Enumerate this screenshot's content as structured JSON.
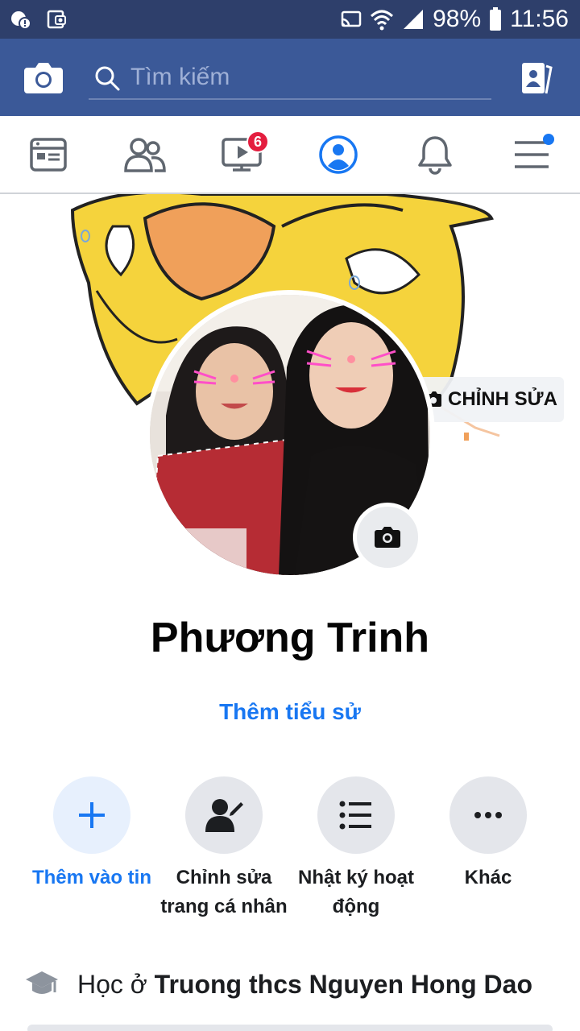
{
  "status_bar": {
    "battery": "98%",
    "time": "11:56"
  },
  "header": {
    "search_placeholder": "Tìm kiếm"
  },
  "tabs": {
    "video_badge": "6",
    "active": "profile"
  },
  "cover": {
    "edit_label": "CHỈNH SỬA"
  },
  "profile": {
    "name": "Phương Trinh",
    "add_bio": "Thêm tiểu sử"
  },
  "actions": [
    {
      "line1": "Thêm vào tin",
      "line2": "",
      "icon": "plus-icon"
    },
    {
      "line1": "Chỉnh sửa",
      "line2": "trang cá nhân",
      "icon": "edit-profile-icon"
    },
    {
      "line1": "Nhật ký hoạt",
      "line2": "động",
      "icon": "list-icon"
    },
    {
      "line1": "Khác",
      "line2": "",
      "icon": "more-icon"
    }
  ],
  "intro": {
    "prefix": "Học ở ",
    "school": "Truong thcs Nguyen Hong Dao"
  },
  "colors": {
    "status_bar": "#2e3f6b",
    "header": "#3b5998",
    "accent": "#1877f2",
    "badge": "#e41e3f"
  }
}
